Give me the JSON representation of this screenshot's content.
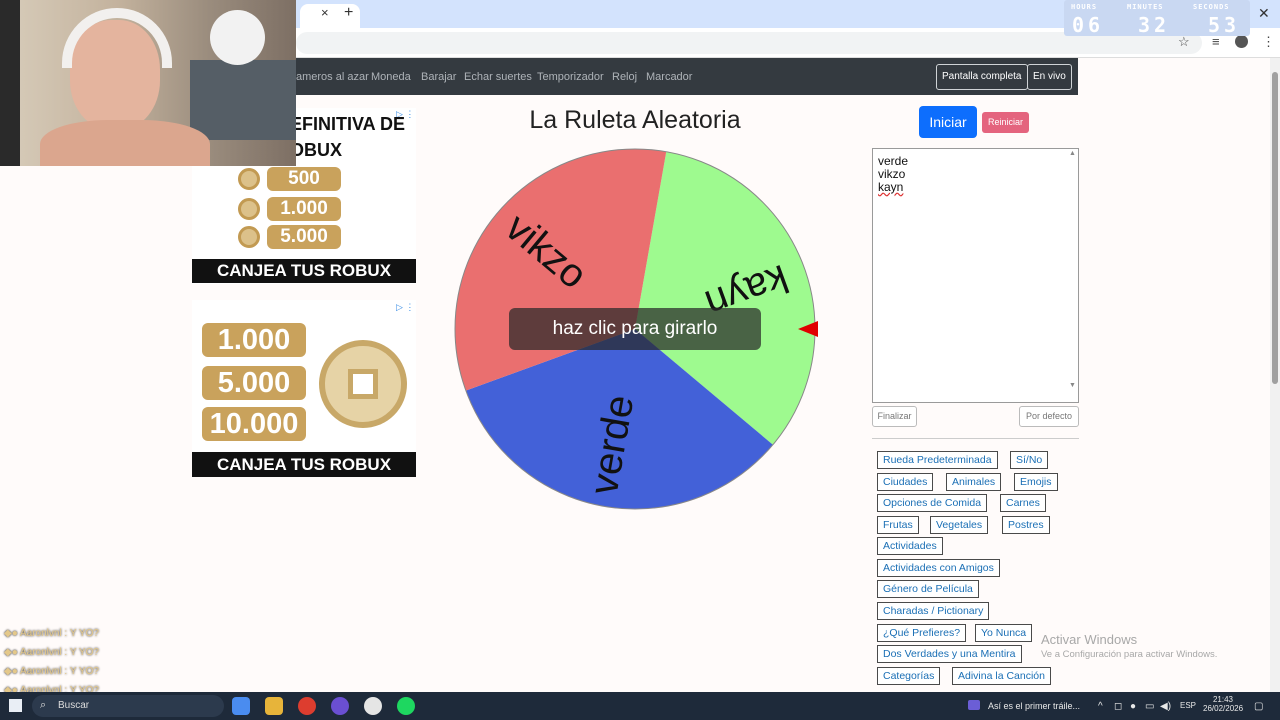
{
  "timer": {
    "hours_label": "HOURS",
    "minutes_label": "MINUTES",
    "seconds_label": "SECONDS",
    "hours": "06",
    "minutes": "32",
    "seconds": "53"
  },
  "browser": {
    "tab_close": "×",
    "new_tab": "+",
    "window_close": "✕"
  },
  "nav": {
    "links": [
      "ameros al azar",
      "Moneda",
      "Barajar",
      "Echar suertes",
      "Temporizador",
      "Reloj",
      "Marcador"
    ],
    "fullscreen": "Pantalla completa",
    "live": "En vivo"
  },
  "ads": {
    "ad1_title_1": "EFINITIVA DE",
    "ad1_title_2": "OBUX",
    "ad1_amounts": [
      "500",
      "1.000",
      "5.000"
    ],
    "ad1_banner": "CANJEA TUS ROBUX",
    "ad2_amounts": [
      "1.000",
      "5.000",
      "10.000"
    ],
    "ad2_banner": "CANJEA TUS ROBUX"
  },
  "wheel": {
    "title": "La Ruleta Aleatoria",
    "spin_label": "haz clic para girarlo",
    "segments": [
      {
        "label": "kayn",
        "color": "#9efa8f"
      },
      {
        "label": "verde",
        "color": "#4361d8"
      },
      {
        "label": "vikzo",
        "color": "#ea6f6f"
      }
    ],
    "pointer_color": "#e00000"
  },
  "panel": {
    "start": "Iniciar",
    "reset": "Reiniciar",
    "entries": [
      "verde",
      "vikzo",
      "kayn"
    ],
    "finish": "Finalizar",
    "default": "Por defecto",
    "presets": [
      [
        "Rueda Predeterminada",
        "Sí/No"
      ],
      [
        "Ciudades",
        "Animales",
        "Emojis"
      ],
      [
        "Opciones de Comida",
        "Carnes"
      ],
      [
        "Frutas",
        "Vegetales",
        "Postres"
      ],
      [
        "Actividades"
      ],
      [
        "Actividades con Amigos"
      ],
      [
        "Género de Película"
      ],
      [
        "Charadas / Pictionary"
      ],
      [
        "¿Qué Prefieres?",
        "Yo Nunca"
      ],
      [
        "Dos Verdades y una Mentira"
      ],
      [
        "Categorías",
        "Adivina la Canción"
      ]
    ]
  },
  "activate_windows": {
    "title": "Activar Windows",
    "subtitle": "Ve a Configuración para activar Windows."
  },
  "chat": {
    "lines": [
      "Aaronlvnl : Y YO?",
      "Aaronlvnl : Y YO?",
      "Aaronlvnl : Y YO?",
      "Aaronlvnl : Y YO?"
    ]
  },
  "taskbar": {
    "search": "Buscar",
    "media": "Así es el primer tráile...",
    "lang": "ESP",
    "time": "21:43",
    "date": "26/02/2026"
  }
}
